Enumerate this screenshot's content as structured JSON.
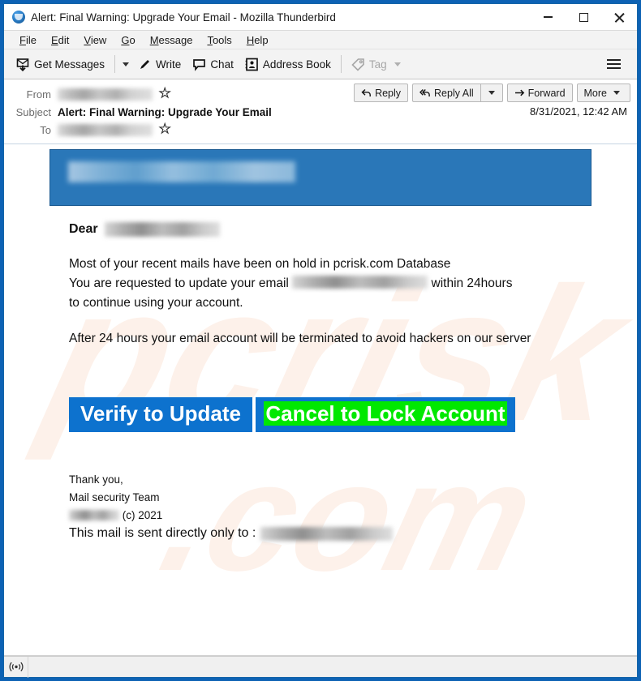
{
  "window": {
    "title": "Alert: Final Warning: Upgrade Your Email - Mozilla Thunderbird",
    "app_icon": "thunderbird-icon",
    "controls": {
      "minimize": "minimize-icon",
      "maximize": "maximize-icon",
      "close": "close-icon"
    }
  },
  "menubar": {
    "items": [
      {
        "label": "File",
        "accesskey": "F"
      },
      {
        "label": "Edit",
        "accesskey": "E"
      },
      {
        "label": "View",
        "accesskey": "V"
      },
      {
        "label": "Go",
        "accesskey": "G"
      },
      {
        "label": "Message",
        "accesskey": "M"
      },
      {
        "label": "Tools",
        "accesskey": "T"
      },
      {
        "label": "Help",
        "accesskey": "H"
      }
    ]
  },
  "toolbar": {
    "get_messages": "Get Messages",
    "get_messages_icon": "get-messages-icon",
    "write": "Write",
    "write_icon": "pencil-icon",
    "chat": "Chat",
    "chat_icon": "chat-bubble-icon",
    "address_book": "Address Book",
    "address_book_icon": "address-book-icon",
    "tag": "Tag",
    "tag_icon": "tag-icon",
    "tag_disabled": true,
    "app_menu_icon": "hamburger-icon"
  },
  "message_header": {
    "from_label": "From",
    "from_value": "",
    "subject_label": "Subject",
    "subject_value": "Alert: Final Warning: Upgrade Your Email",
    "to_label": "To",
    "to_value": "",
    "date": "8/31/2021, 12:42 AM",
    "star_icon": "star-icon",
    "actions": {
      "reply": "Reply",
      "reply_icon": "reply-arrow-icon",
      "reply_all": "Reply All",
      "reply_all_icon": "reply-all-arrow-icon",
      "reply_all_caret": "chevron-down-icon",
      "forward": "Forward",
      "forward_icon": "forward-arrow-icon",
      "more": "More",
      "more_caret": "chevron-down-icon"
    }
  },
  "email": {
    "banner_address_redacted": true,
    "greeting": "Dear",
    "paragraph_1_a": "Most of your recent mails have been on hold in pcrisk.com Database",
    "paragraph_1_b": "You are requested to update your email",
    "paragraph_1_c": "within 24hours",
    "paragraph_1_d": "to continue using your account.",
    "paragraph_2": "After 24 hours your email account will be terminated to avoid hackers on our server",
    "cta_primary": "Verify to Update",
    "cta_secondary": "Cancel to Lock Account",
    "thank_you": "Thank you,",
    "team": "Mail security Team",
    "copyright": "(c) 2021",
    "final_line": "This mail is sent directly only to :",
    "colors": {
      "banner_blue": "#2a77b8",
      "cta_blue": "#0d72ce",
      "highlight_green": "#00e800"
    }
  },
  "watermark": {
    "text": "pcrisk.com",
    "color": "#fdf0e8"
  },
  "statusbar": {
    "icon": "broadcast-signal-icon",
    "text": ""
  }
}
